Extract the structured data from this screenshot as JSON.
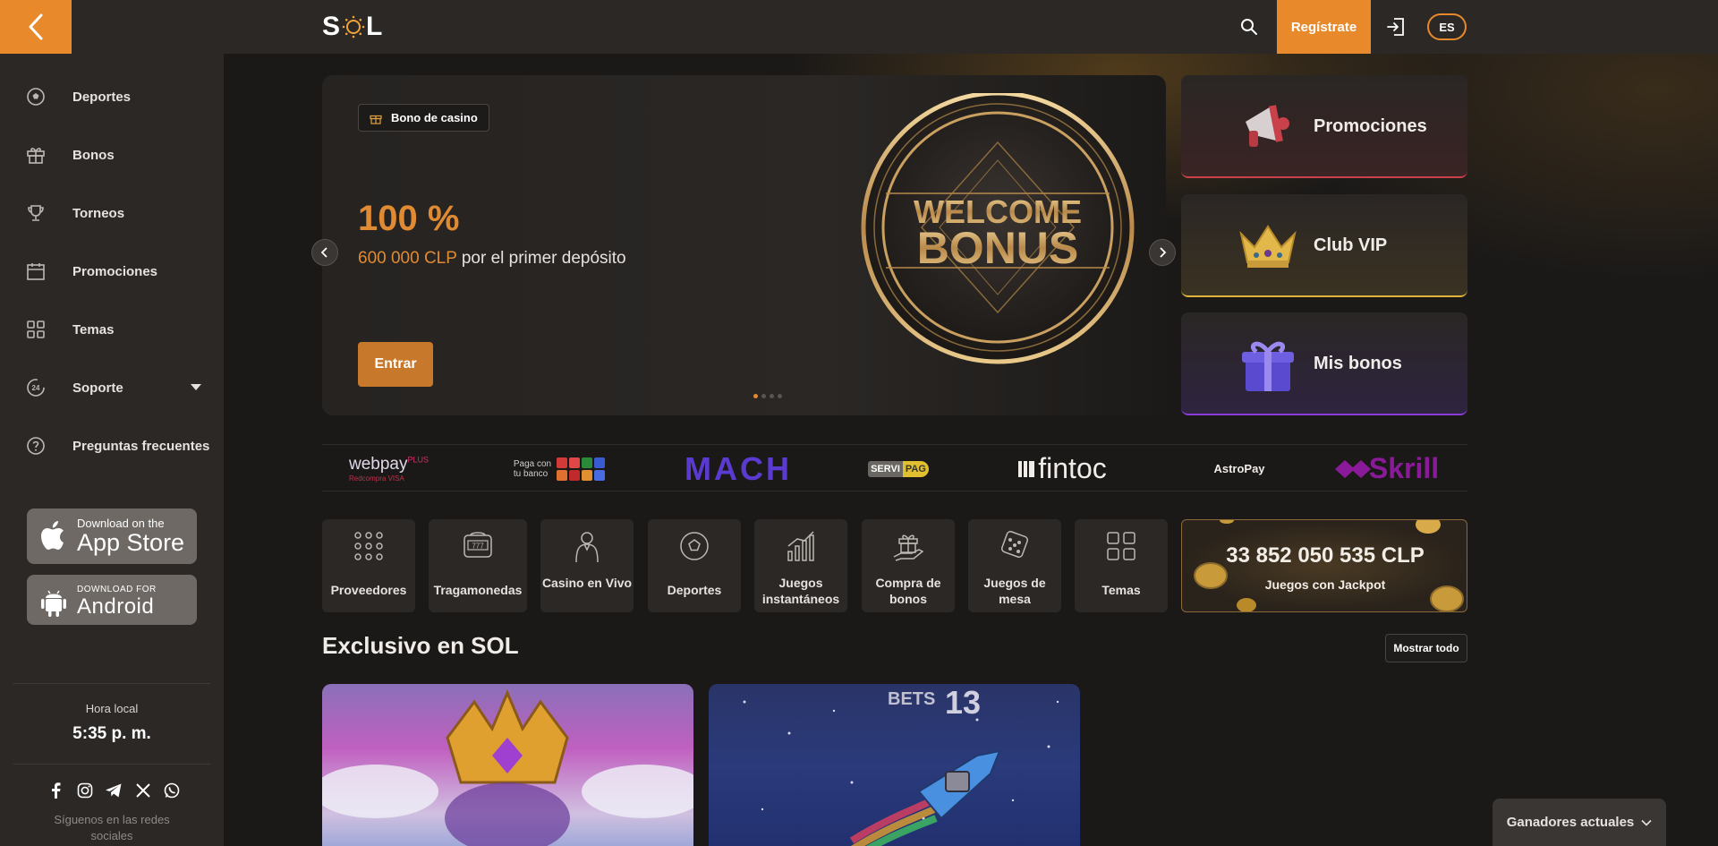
{
  "header": {
    "logo": "SOL",
    "register_label": "Regístrate",
    "lang_label": "ES"
  },
  "sidebar": {
    "items": [
      {
        "label": "Deportes",
        "icon": "soccer-ball-icon"
      },
      {
        "label": "Bonos",
        "icon": "gift-icon"
      },
      {
        "label": "Torneos",
        "icon": "trophy-icon"
      },
      {
        "label": "Promociones",
        "icon": "calendar-icon"
      },
      {
        "label": "Temas",
        "icon": "grid-icon"
      },
      {
        "label": "Soporte",
        "icon": "support-24-icon"
      },
      {
        "label": "Preguntas frecuentes",
        "icon": "question-circle-icon"
      }
    ],
    "app_store": {
      "small": "Download on the",
      "big": "App Store"
    },
    "android": {
      "small": "DOWNLOAD FOR",
      "big": "Android"
    },
    "local_time_label": "Hora local",
    "local_time": "5:35 p. m.",
    "social_text": "Síguenos en las redes sociales"
  },
  "banner": {
    "tag": "Bono de casino",
    "percent": "100 %",
    "amount": "600 000 CLP",
    "subtitle_rest": " por el primer depósito",
    "button": "Entrar",
    "coin_line1": "WELCOME",
    "coin_line2": "BONUS",
    "slide_count": 4,
    "active_slide": 1
  },
  "side_cards": [
    {
      "label": "Promociones",
      "accent": "#c9414a"
    },
    {
      "label": "Club VIP",
      "accent": "#e0b43a"
    },
    {
      "label": "Mis bonos",
      "accent": "#8a3bd8"
    }
  ],
  "payments": {
    "webpay": "webpay",
    "webpay_plus": "PLUS",
    "webpay_sub": "Redcompra  VISA",
    "pagacon_1": "Paga con",
    "pagacon_2": "tu banco",
    "mach": "MACH",
    "servi": "SERVI",
    "pag": "PAG",
    "fintoc": "fintoc",
    "astropay": "AstroPay",
    "skrill": "Skrill"
  },
  "categories": [
    {
      "label": "Proveedores",
      "icon": "dots-grid-icon"
    },
    {
      "label": "Tragamonedas",
      "icon": "slot-machine-icon"
    },
    {
      "label": "Casino en Vivo",
      "icon": "live-dealer-icon"
    },
    {
      "label": "Deportes",
      "icon": "soccer-ball-icon"
    },
    {
      "label": "Juegos instantáneos",
      "icon": "bar-chart-icon"
    },
    {
      "label": "Compra de bonos",
      "icon": "gift-hand-icon"
    },
    {
      "label": "Juegos de mesa",
      "icon": "dice-icon"
    },
    {
      "label": "Temas",
      "icon": "grid-icon"
    }
  ],
  "jackpot": {
    "amount": "33 852 050 535 CLP",
    "label": "Juegos con Jackpot"
  },
  "section": {
    "title": "Exclusivo en SOL",
    "show_all": "Mostrar todo"
  },
  "games": [
    {
      "label": "",
      "overlay": ""
    },
    {
      "label": "BETS",
      "overlay": "13"
    }
  ],
  "winners": {
    "label": "Ganadores actuales"
  },
  "colors": {
    "accent": "#e8892b",
    "sidebar": "#2b2826",
    "background": "#1b1918"
  }
}
